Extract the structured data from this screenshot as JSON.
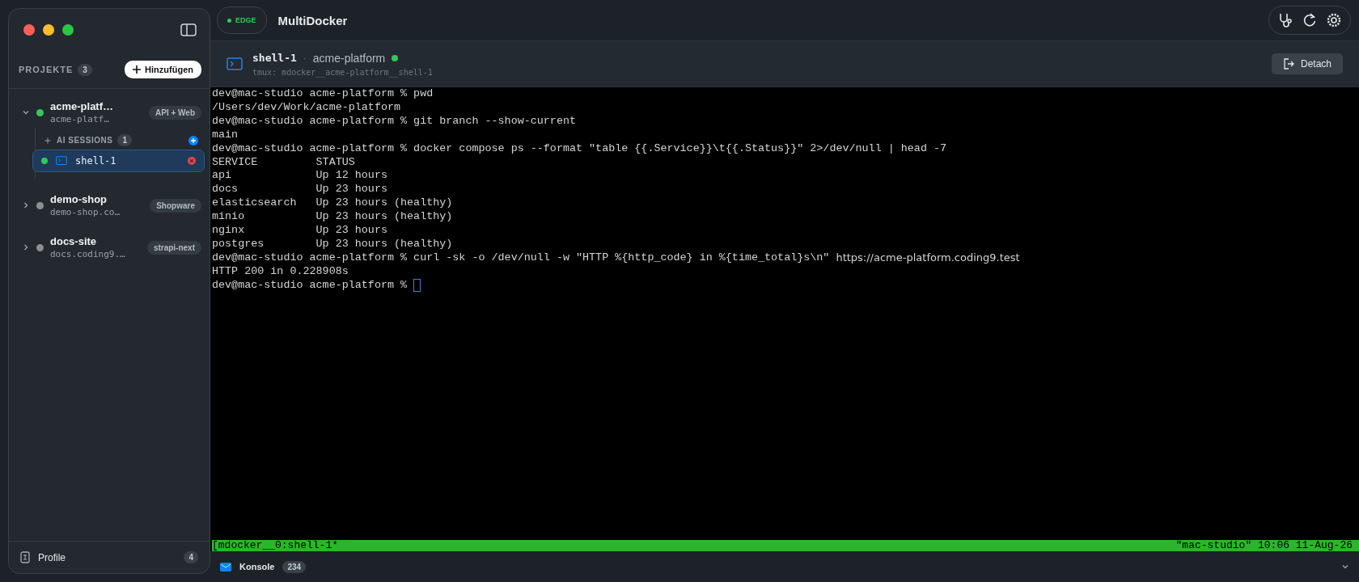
{
  "sidebar": {
    "header": {
      "label": "PROJEKTE",
      "count": "3",
      "add_button": "Hinzufügen"
    },
    "projects": [
      {
        "name": "acme-platf…",
        "host": "acme-platf…",
        "tag": "API + Web",
        "expanded": true,
        "color": "#34c759",
        "sessions": {
          "label": "AI SESSIONS",
          "count": "1",
          "items": [
            {
              "name": "shell-1",
              "selected": true,
              "color": "#34c759"
            }
          ]
        }
      },
      {
        "name": "demo-shop",
        "host": "demo-shop.co…",
        "tag": "Shopware",
        "expanded": false,
        "color": "#8e8e93"
      },
      {
        "name": "docs-site",
        "host": "docs.coding9.…",
        "tag": "strapi-next",
        "expanded": false,
        "color": "#8e8e93"
      }
    ],
    "footer": {
      "label": "Profile",
      "count": "4"
    }
  },
  "topbar": {
    "badge": "EDGE",
    "title": "MultiDocker"
  },
  "session_header": {
    "name": "shell-1",
    "separator": "·",
    "project": "acme-platform",
    "subtitle": "tmux: mdocker__acme-platform__shell-1",
    "detach_button": "Detach"
  },
  "terminal": {
    "lines": [
      {
        "text": "dev@mac-studio acme-platform % pwd"
      },
      {
        "text": "/Users/dev/Work/acme-platform"
      },
      {
        "text": "dev@mac-studio acme-platform % git branch --show-current"
      },
      {
        "text": "main"
      },
      {
        "text": "dev@mac-studio acme-platform % docker compose ps --format \"table {{.Service}}\\t{{.Status}}\" 2>/dev/null | head -7"
      },
      {
        "text": "SERVICE         STATUS"
      },
      {
        "text": "api             Up 12 hours"
      },
      {
        "text": "docs            Up 23 hours"
      },
      {
        "text": "elasticsearch   Up 23 hours (healthy)"
      },
      {
        "text": "minio           Up 23 hours (healthy)"
      },
      {
        "text": "nginx           Up 23 hours"
      },
      {
        "text": "postgres        Up 23 hours (healthy)"
      },
      {
        "text": "dev@mac-studio acme-platform % curl -sk -o /dev/null -w \"HTTP %{http_code} in %{time_total}s\\n\"",
        "trailing": "https://acme-platform.coding9.test"
      },
      {
        "text": "HTTP 200 in 0.228908s"
      },
      {
        "text": "dev@mac-studio acme-platform % ",
        "cursor": true
      }
    ],
    "status_left": "[mdocker__0:shell-1*",
    "status_right": "\"mac-studio\" 10:06 11-Aug-26"
  },
  "bottom_bar": {
    "label": "Konsole",
    "count": "234"
  }
}
